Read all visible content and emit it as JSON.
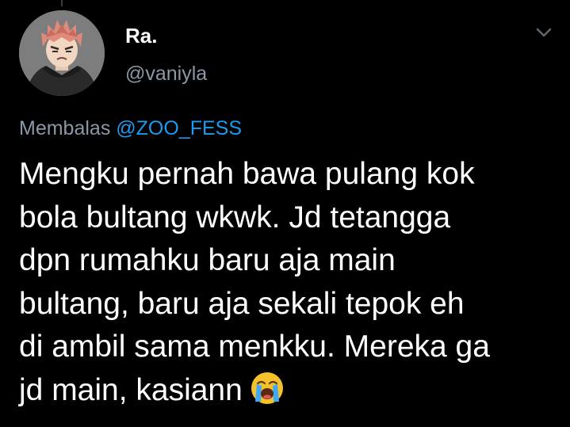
{
  "tweet": {
    "author": {
      "display_name": "Ra.",
      "handle": "@vaniyla",
      "avatar_icon": "anime-avatar"
    },
    "reply_to": {
      "prefix": "Membalas",
      "mention": "@ZOO_FESS"
    },
    "body_lines": [
      "Mengku pernah bawa pulang kok",
      "bola bultang wkwk. Jd tetangga",
      "dpn rumahku baru aja main",
      "bultang, baru aja sekali tepok eh",
      "di ambil sama menkku. Mereka ga",
      "jd main, kasiann"
    ],
    "emoji": "loudly-crying-face",
    "menu_icon": "chevron-down-icon"
  },
  "colors": {
    "background": "#000000",
    "primary_text": "#ffffff",
    "secondary_text": "#8b98a5",
    "link": "#1d9bf0"
  }
}
